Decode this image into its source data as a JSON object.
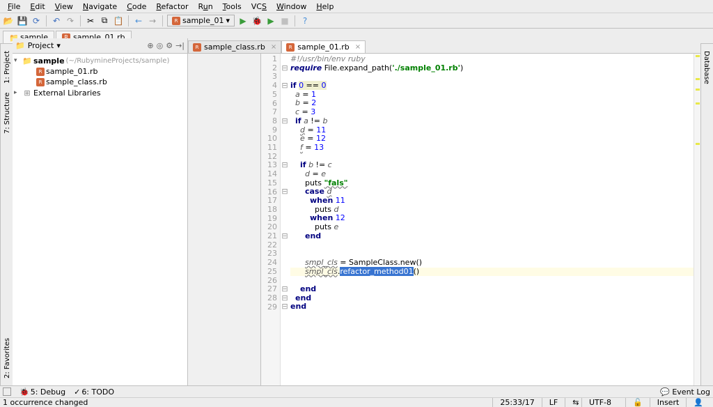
{
  "menu": [
    "File",
    "Edit",
    "View",
    "Navigate",
    "Code",
    "Refactor",
    "Run",
    "Tools",
    "VCS",
    "Window",
    "Help"
  ],
  "run_config": "sample_01",
  "nav_tabs": [
    {
      "label": "sample",
      "type": "folder"
    },
    {
      "label": "sample_01.rb",
      "type": "rb"
    }
  ],
  "left_tools": [
    "1: Project",
    "7: Structure",
    "2: Favorites"
  ],
  "right_tools": [
    "Database"
  ],
  "project": {
    "header": "Project",
    "tree": {
      "root": {
        "name": "sample",
        "path": "(~/RubymineProjects/sample)"
      },
      "files": [
        "sample_01.rb",
        "sample_class.rb"
      ],
      "ext_lib": "External Libraries"
    }
  },
  "editor_tabs": [
    {
      "label": "sample_class.rb",
      "active": false
    },
    {
      "label": "sample_01.rb",
      "active": true
    }
  ],
  "code": {
    "lines": [
      {
        "n": 1,
        "html": "<span class='comment'>#!/usr/bin/env ruby</span>"
      },
      {
        "n": 2,
        "html": "<span class='kw' style='font-style:italic'>require</span> File.expand_path(<span class='str'>'./sample_01.rb'</span>)"
      },
      {
        "n": 3,
        "html": ""
      },
      {
        "n": 4,
        "html": "<span class='kw'>if</span> <span style='background:#efefd0'><span class='num'>0</span> == <span class='num'>0</span></span>"
      },
      {
        "n": 5,
        "html": "  <span class='ital'>a</span> = <span class='num'>1</span>"
      },
      {
        "n": 6,
        "html": "  <span class='ital'>b</span> = <span class='num'>2</span>"
      },
      {
        "n": 7,
        "html": "  <span class='ital'>c</span> = <span class='num'>3</span>"
      },
      {
        "n": 8,
        "html": "  <span class='kw'>if</span> <span class='ital'>a</span> != <span class='ital'>b</span>"
      },
      {
        "n": 9,
        "html": "    <span class='ital wavy'>d</span> = <span class='num'>11</span>"
      },
      {
        "n": 10,
        "html": "    <span class='ital'>e</span> = <span class='num'>12</span>"
      },
      {
        "n": 11,
        "html": "    <span class='ital wavy'>f</span> = <span class='num'>13</span>"
      },
      {
        "n": 12,
        "html": ""
      },
      {
        "n": 13,
        "html": "    <span class='kw'>if</span> <span class='ital'>b</span> != <span class='ital'>c</span>"
      },
      {
        "n": 14,
        "html": "      <span class='ital'>d</span> = <span class='ital'>e</span>"
      },
      {
        "n": 15,
        "html": "      puts <span class='str wavy'>\"fals\"</span>"
      },
      {
        "n": 16,
        "html": "      <span class='kw'>case</span> <span class='ital wavy'>d</span>"
      },
      {
        "n": 17,
        "html": "        <span class='kw'>when</span> <span class='num'>11</span>"
      },
      {
        "n": 18,
        "html": "          puts <span class='ital'>d</span>"
      },
      {
        "n": 19,
        "html": "        <span class='kw'>when</span> <span class='num'>12</span>"
      },
      {
        "n": 20,
        "html": "          puts <span class='ital'>e</span>"
      },
      {
        "n": 21,
        "html": "      <span class='kw'>end</span>"
      },
      {
        "n": 22,
        "html": ""
      },
      {
        "n": 23,
        "html": ""
      },
      {
        "n": 24,
        "html": "      <span class='ital wavy'>smpl_cls</span> = SampleClass.new()"
      },
      {
        "n": 25,
        "html": "      <span class='ital wavy'>smpl_cls</span>.<span class='sel'>refactor_method01</span>()",
        "hl": true
      },
      {
        "n": 26,
        "html": ""
      },
      {
        "n": 27,
        "html": "    <span class='kw'>end</span>"
      },
      {
        "n": 28,
        "html": "  <span class='kw'>end</span>"
      },
      {
        "n": 29,
        "html": "<span class='kw'>end</span>"
      }
    ]
  },
  "bottom_tools": {
    "debug": "5: Debug",
    "todo": "6: TODO",
    "event_log": "Event Log"
  },
  "status": {
    "msg": "1 occurrence changed",
    "pos": "25:33/17",
    "line_sep": "LF",
    "encoding": "UTF-8",
    "insert": "Insert"
  }
}
